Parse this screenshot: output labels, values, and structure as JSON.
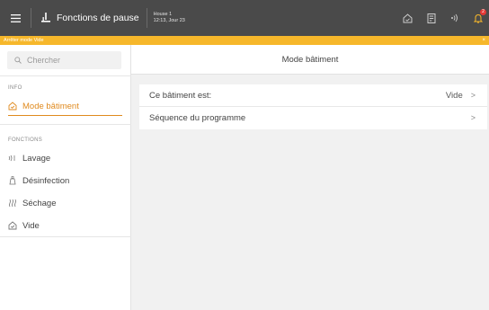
{
  "header": {
    "app_title": "Fonctions de pause",
    "house_name": "House 1",
    "house_time": "12:13, Jour 23",
    "notification_count": "2",
    "icons": [
      "menu-icon",
      "pause-functions-icon",
      "home-icon",
      "document-icon",
      "wifi-icon",
      "bell-icon"
    ]
  },
  "banner": {
    "text": "Arrêter mode Vide",
    "close": "×"
  },
  "sidebar": {
    "search_placeholder": "Chercher",
    "info_label": "INFO",
    "info_items": [
      {
        "label": "Mode bâtiment",
        "icon": "building-mode-icon",
        "active": true
      }
    ],
    "functions_label": "FONCTIONS",
    "function_items": [
      {
        "label": "Lavage",
        "icon": "washing-icon"
      },
      {
        "label": "Désinfection",
        "icon": "disinfection-icon"
      },
      {
        "label": "Séchage",
        "icon": "drying-icon"
      },
      {
        "label": "Vide",
        "icon": "empty-icon"
      }
    ]
  },
  "main": {
    "title": "Mode bâtiment",
    "rows": [
      {
        "label": "Ce bâtiment est:",
        "value": "Vide",
        "chevron": ">"
      },
      {
        "label": "Séquence du programme",
        "value": "",
        "chevron": ">"
      }
    ]
  },
  "colors": {
    "topbar": "#4a4a4a",
    "banner": "#f6b72b",
    "accent": "#e08a1e",
    "badge": "#e53935"
  }
}
